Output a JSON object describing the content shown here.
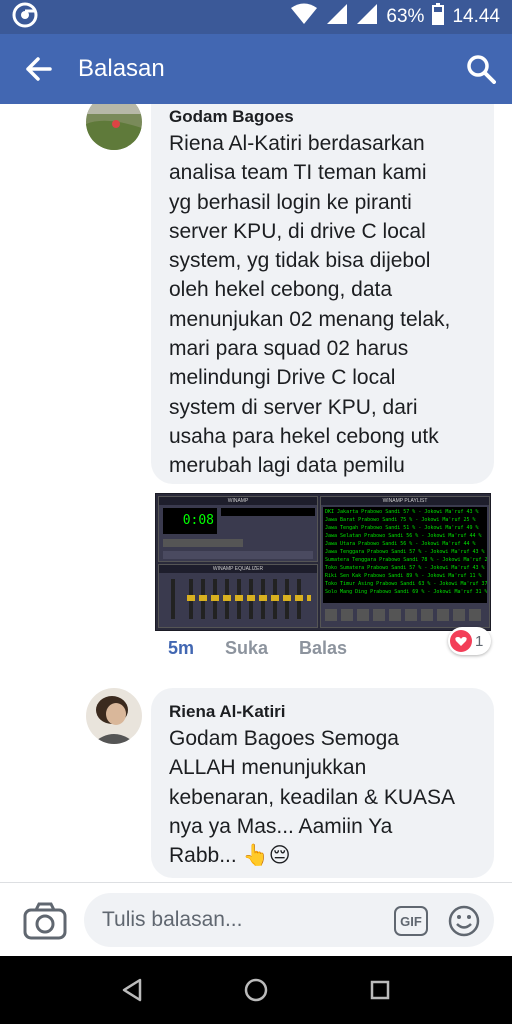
{
  "status_bar": {
    "battery": "63%",
    "time": "14.44"
  },
  "app_bar": {
    "title": "Balasan"
  },
  "comments": [
    {
      "author": "Godam Bagoes",
      "text": "Riena Al-Katiri berdasarkan\nanalisa team TI teman kami\nyg berhasil login ke piranti\nserver KPU, di drive C local\nsystem, yg tidak bisa dijebol\noleh hekel cebong, data\nmenunjukan 02 menang telak,\nmari para squad 02 harus\nmelindungi Drive C local\nsystem di server KPU, dari\nusaha para hekel cebong utk\nmerubah lagi data pemilu",
      "attachment": {
        "type": "image",
        "description_icon": "winamp-screenshot",
        "player_title": "WINAMP",
        "time_display": "0:08",
        "equalizer_title": "WINAMP EQUALIZER",
        "playlist_title": "WINAMP PLAYLIST",
        "playlist_lines": [
          "DKI Jakarta        Prabowo Sandi 57 % - Jokowi Ma'ruf 43 %",
          "Jawa Barat         Prabowo Sandi 75 % - Jokowi Ma'ruf 25 %",
          "Jawa Tengah        Prabowo Sandi 51 % - Jokowi Ma'ruf 49 %",
          "Jawa Selatan       Prabowo Sandi 56 % - Jokowi Ma'ruf 44 %",
          "Jawa Utara         Prabowo Sandi 56 % - Jokowi Ma'ruf 44 %",
          "Jawa Tenggara      Prabowo Sandi 57 % - Jokowi Ma'ruf 43 %",
          "Sumatera Tenggara  Prabowo Sandi 78 % - Jokowi Ma'ruf 22 %",
          "Toko Sumatera      Prabowo Sandi 57 % - Jokowi Ma'ruf 43 %",
          "Riki Sen Kak       Prabowo Sandi 89 % - Jokowi Ma'ruf 11 %",
          "Toko Timur Asing   Prabowo Sandi 63 % - Jokowi Ma'ruf 37 %",
          "Solo Mang Ding     Prabowo Sandi 69 % - Jokowi Ma'ruf 31 %"
        ]
      },
      "time": "5m",
      "like_label": "Suka",
      "reply_label": "Balas",
      "reaction_count": "1"
    },
    {
      "author": "Riena Al-Katiri",
      "text": "Godam Bagoes Semoga\nALLAH menunjukkan\nkebenaran, keadilan & KUASA\nnya ya Mas... Aamiin Ya\nRabb...",
      "emojis": "👆😔"
    }
  ],
  "composer": {
    "placeholder": "Tulis balasan...",
    "gif_label": "GIF"
  },
  "colors": {
    "brand": "#4267b2",
    "status": "#3b5998",
    "bubble": "#f0f2f5"
  }
}
